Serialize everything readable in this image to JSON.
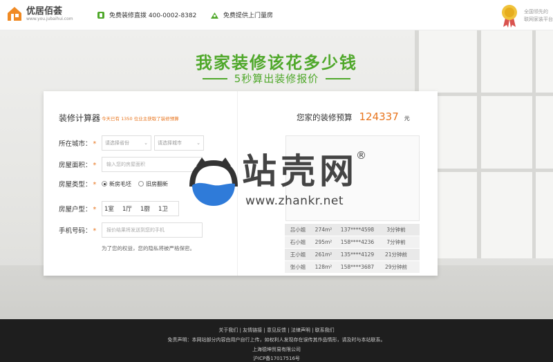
{
  "header": {
    "logo_name": "优居佰荟",
    "logo_url": "www.you.jubaihui.com",
    "hotline": "免费装修直拨 400-0002-8382",
    "measure": "免费提供上门量房",
    "right_text_1": "全国领先的",
    "right_text_2": "联网家装平台",
    "icons": [
      "house-logo-icon",
      "phone-icon",
      "home-measure-icon",
      "medal-icon"
    ]
  },
  "hero": {
    "slogan": "我家装修该花多少钱",
    "subslogan": "5秒算出装修报价"
  },
  "calculator": {
    "title": "装修计算器",
    "note_prefix": "今天已有",
    "note_count": "1350",
    "note_suffix": "位业主获取了装修预算",
    "city_label": "所在城市：",
    "province_placeholder": "请选择省份",
    "city_placeholder": "请选择城市",
    "area_label": "房屋面积：",
    "area_placeholder": "输入您的房屋面积",
    "type_label": "房屋类型：",
    "type_option_1": "新房毛坯",
    "type_option_2": "旧房翻新",
    "layout_label": "房屋户型：",
    "layout_units": [
      "1室",
      "1厅",
      "1厨",
      "1卫"
    ],
    "phone_label": "手机号码：",
    "phone_placeholder": "报价结果将发送到您的手机",
    "required_mark": "*",
    "privacy": "为了您的权益，您的隐私将被严格保密。"
  },
  "budget": {
    "label": "您家的装修预算",
    "value": "124337",
    "unit": "元",
    "orders": [
      {
        "name": "吕小姐",
        "area": "274m²",
        "phone": "137****4598",
        "time": "3分钟前"
      },
      {
        "name": "石小姐",
        "area": "295m²",
        "phone": "158****4236",
        "time": "7分钟前"
      },
      {
        "name": "王小姐",
        "area": "261m²",
        "phone": "135****4129",
        "time": "21分钟前"
      },
      {
        "name": "张小姐",
        "area": "128m²",
        "phone": "158****3687",
        "time": "29分钟前"
      }
    ]
  },
  "watermark": {
    "title": "站壳网",
    "reg": "®",
    "url": "www.zhankr.net"
  },
  "footer": {
    "links": [
      "关于我们",
      "友情链接",
      "意见反馈",
      "法律声明",
      "联系我们"
    ],
    "separator": "|",
    "disclaimer": "免责声明：本网站部分内容由用户自行上传，如权利人发现存在误传其作品情形，请及时与本站联系。",
    "company": "上海德坤贸易有限公司",
    "icp": "沪ICP备17017516号"
  },
  "colors": {
    "accent_green": "#4fa82a",
    "accent_orange": "#e8741c",
    "footer_bg": "#1e1e1e",
    "watermark_blue": "#2f7bd9"
  }
}
